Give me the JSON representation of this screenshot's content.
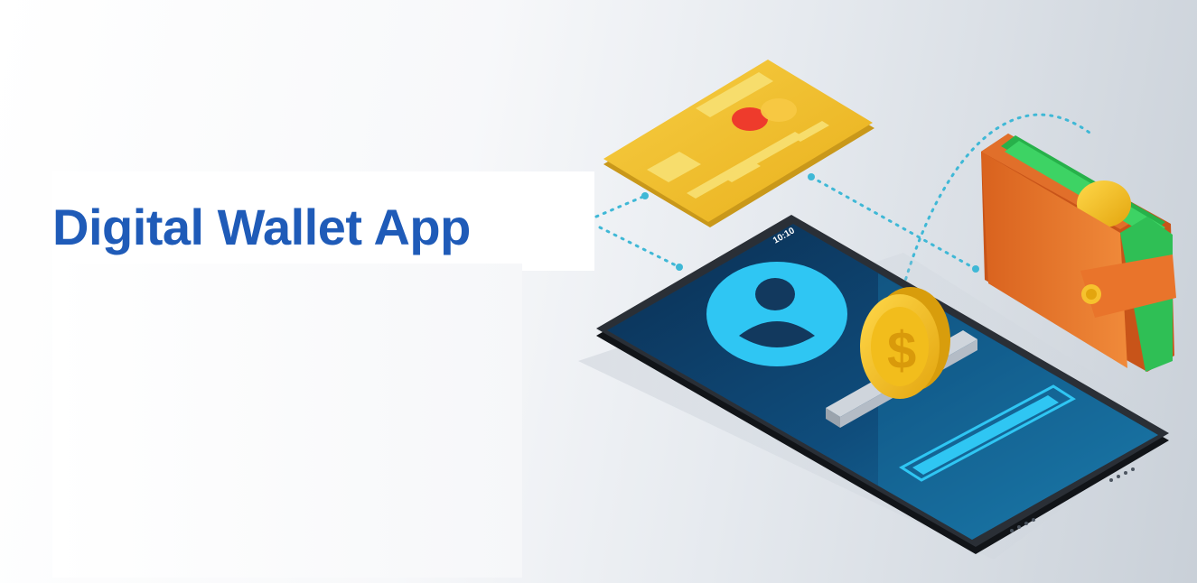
{
  "headline": {
    "text": "Digital Wallet App",
    "color": "#1f5bb8"
  },
  "phone": {
    "status_time": "10:10"
  },
  "icons": {
    "card": "credit-card-icon",
    "wallet": "wallet-icon",
    "coin": "dollar-coin-icon",
    "avatar": "user-avatar-icon",
    "coin_symbol": "$"
  },
  "colors": {
    "card": "#f2c12e",
    "wallet": "#e8772e",
    "screen": "#0e4a77",
    "accent": "#29c4f0",
    "coin": "#f5c518"
  }
}
